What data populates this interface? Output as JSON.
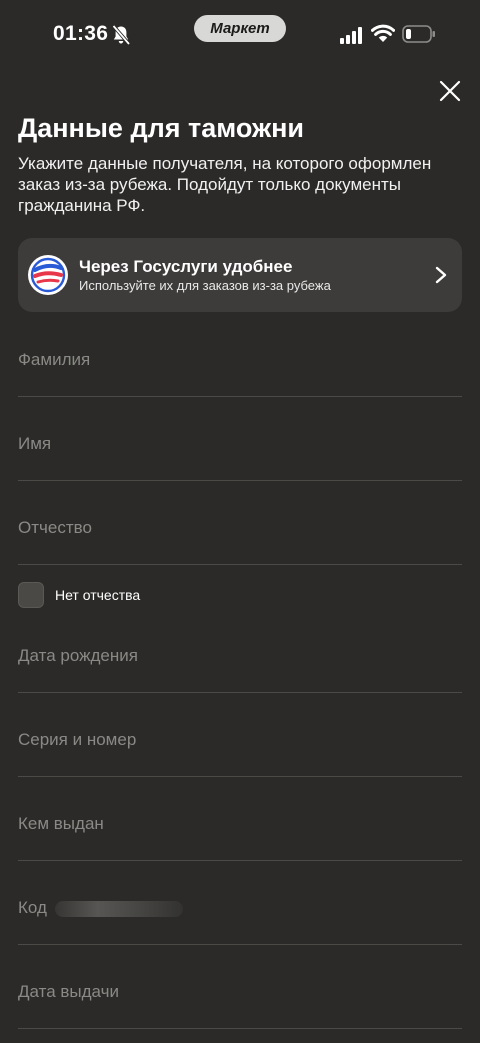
{
  "status_bar": {
    "time": "01:36",
    "app_pill": "Маркет"
  },
  "header": {
    "title": "Данные для таможни",
    "subtitle": "Укажите данные получателя, на которого оформлен заказ из-за рубежа. Подойдут только документы гражданина РФ."
  },
  "gosuslugi": {
    "title": "Через Госуслуги удобнее",
    "description": "Используйте их для заказов из-за рубежа"
  },
  "fields": {
    "last_name": "Фамилия",
    "first_name": "Имя",
    "patronymic": "Отчество",
    "no_patronymic": "Нет отчества",
    "birth_date": "Дата рождения",
    "passport_series": "Серия и номер",
    "issued_by": "Кем выдан",
    "code": "Код",
    "issue_date": "Дата выдачи"
  },
  "colors": {
    "background": "#2b2a28",
    "card": "#3d3c3a",
    "placeholder": "#8a8986",
    "divider": "#4b4a47"
  },
  "icons": [
    "bell-mute-icon",
    "signal-icon",
    "wifi-icon",
    "battery-icon",
    "close-icon",
    "gosuslugi-logo-icon",
    "chevron-right-icon"
  ]
}
